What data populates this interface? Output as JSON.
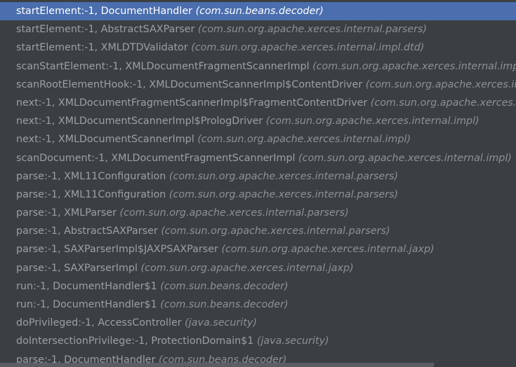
{
  "frames": [
    {
      "location": "startElement:-1, DocumentHandler",
      "package": "(com.sun.beans.decoder)",
      "selected": true
    },
    {
      "location": "startElement:-1, AbstractSAXParser",
      "package": "(com.sun.org.apache.xerces.internal.parsers)"
    },
    {
      "location": "startElement:-1, XMLDTDValidator",
      "package": "(com.sun.org.apache.xerces.internal.impl.dtd)"
    },
    {
      "location": "scanStartElement:-1, XMLDocumentFragmentScannerImpl",
      "package": "(com.sun.org.apache.xerces.internal.impl)"
    },
    {
      "location": "scanRootElementHook:-1, XMLDocumentScannerImpl$ContentDriver",
      "package": "(com.sun.org.apache.xerces.internal.impl)"
    },
    {
      "location": "next:-1, XMLDocumentFragmentScannerImpl$FragmentContentDriver",
      "package": "(com.sun.org.apache.xerces.internal.impl)"
    },
    {
      "location": "next:-1, XMLDocumentScannerImpl$PrologDriver",
      "package": "(com.sun.org.apache.xerces.internal.impl)"
    },
    {
      "location": "next:-1, XMLDocumentScannerImpl",
      "package": "(com.sun.org.apache.xerces.internal.impl)"
    },
    {
      "location": "scanDocument:-1, XMLDocumentFragmentScannerImpl",
      "package": "(com.sun.org.apache.xerces.internal.impl)"
    },
    {
      "location": "parse:-1, XML11Configuration",
      "package": "(com.sun.org.apache.xerces.internal.parsers)"
    },
    {
      "location": "parse:-1, XML11Configuration",
      "package": "(com.sun.org.apache.xerces.internal.parsers)"
    },
    {
      "location": "parse:-1, XMLParser",
      "package": "(com.sun.org.apache.xerces.internal.parsers)"
    },
    {
      "location": "parse:-1, AbstractSAXParser",
      "package": "(com.sun.org.apache.xerces.internal.parsers)"
    },
    {
      "location": "parse:-1, SAXParserImpl$JAXPSAXParser",
      "package": "(com.sun.org.apache.xerces.internal.jaxp)"
    },
    {
      "location": "parse:-1, SAXParserImpl",
      "package": "(com.sun.org.apache.xerces.internal.jaxp)"
    },
    {
      "location": "run:-1, DocumentHandler$1",
      "package": "(com.sun.beans.decoder)"
    },
    {
      "location": "run:-1, DocumentHandler$1",
      "package": "(com.sun.beans.decoder)"
    },
    {
      "location": "doPrivileged:-1, AccessController",
      "package": "(java.security)"
    },
    {
      "location": "doIntersectionPrivilege:-1, ProtectionDomain$1",
      "package": "(java.security)"
    },
    {
      "location": "parse:-1, DocumentHandler",
      "package": "(com.sun.beans.decoder)"
    }
  ],
  "colors": {
    "background": "#3c3f41",
    "selection": "#4b6eaf",
    "text": "#9aa0a6",
    "selected_text": "#ffffff"
  }
}
